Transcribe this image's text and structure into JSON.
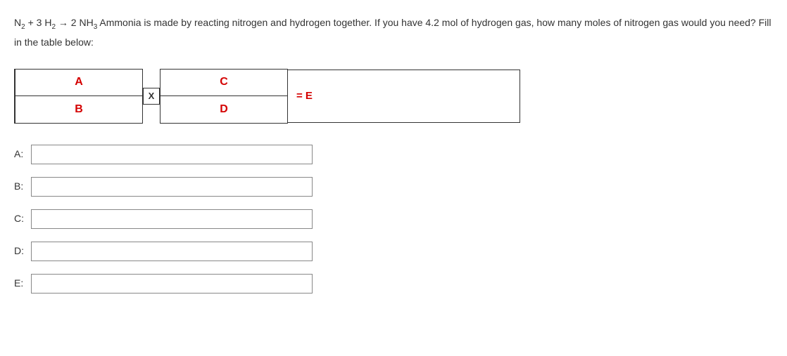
{
  "question": {
    "equation_parts": [
      "N",
      "2",
      " + 3 H",
      "2",
      " → 2 NH",
      "3"
    ],
    "text_after": "    Ammonia is made by reacting nitrogen and hydrogen together. If you have 4.2 mol of hydrogen gas, how many moles of nitrogen gas would you need? Fill in the table below:"
  },
  "diagram": {
    "frac1_top": "A",
    "frac1_bottom": "B",
    "multiply": "X",
    "frac2_top": "C",
    "frac2_bottom": "D",
    "result": "= E"
  },
  "fields": [
    {
      "label": "A:",
      "value": ""
    },
    {
      "label": "B:",
      "value": ""
    },
    {
      "label": "C:",
      "value": ""
    },
    {
      "label": "D:",
      "value": ""
    },
    {
      "label": "E:",
      "value": ""
    }
  ]
}
